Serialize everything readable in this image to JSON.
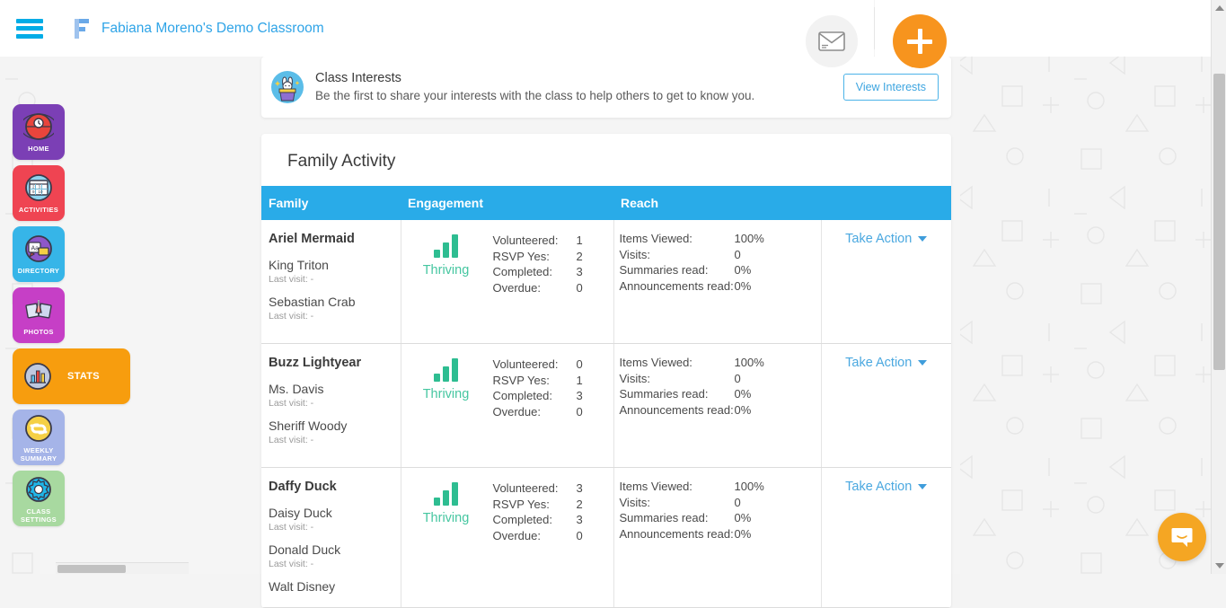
{
  "header": {
    "menu_icon": "hamburger-menu-icon",
    "logo_icon": "f-logo-icon",
    "class_title": "Fabiana Moreno's Demo Classroom",
    "mail_icon": "envelope-icon",
    "add_icon": "plus-icon"
  },
  "sidebar": {
    "items": [
      {
        "label": "HOME",
        "icon": "home-globe-icon",
        "color": "#7b3fb5",
        "active": false
      },
      {
        "label": "ACTIVITIES",
        "icon": "calendar-globe-icon",
        "color": "#ef4452",
        "active": false
      },
      {
        "label": "DIRECTORY",
        "icon": "directory-icon",
        "color": "#36b5e8",
        "active": false
      },
      {
        "label": "PHOTOS",
        "icon": "photos-icon",
        "color": "#c63fc6",
        "active": false
      },
      {
        "label": "STATS",
        "icon": "stats-chart-icon",
        "color": "#f79d0e",
        "active": true
      },
      {
        "label": "WEEKLY\nSUMMARY",
        "icon": "refresh-cycle-icon",
        "color": "#a5b4e8",
        "active": false
      },
      {
        "label": "CLASS\nSETTINGS",
        "icon": "gear-icon",
        "color": "#a8d9a0",
        "active": false
      }
    ]
  },
  "interests_banner": {
    "icon": "magic-hat-rabbit-icon",
    "title": "Class Interests",
    "subtitle": "Be the first to share your interests with the class to help others to get to know you.",
    "button_label": "View Interests"
  },
  "family_activity": {
    "title": "Family Activity",
    "columns": [
      "Family",
      "Engagement",
      "Reach",
      ""
    ],
    "engagement_keys": [
      "Volunteered:",
      "RSVP Yes:",
      "Completed:",
      "Overdue:"
    ],
    "reach_keys": [
      "Items Viewed:",
      "Visits:",
      "Summaries read:",
      "Announcements read:"
    ],
    "action_label": "Take Action",
    "last_visit_label": "Last visit: -",
    "rows": [
      {
        "family": "Ariel Mermaid",
        "members": [
          {
            "name": "King Triton",
            "last_visit": "Last visit: -"
          },
          {
            "name": "Sebastian Crab",
            "last_visit": "Last visit: -"
          }
        ],
        "status": "Thriving",
        "engagement_values": [
          "1",
          "2",
          "3",
          "0"
        ],
        "reach_values": [
          "100%",
          "0",
          "0%",
          "0%"
        ],
        "action": "Take Action"
      },
      {
        "family": "Buzz Lightyear",
        "members": [
          {
            "name": "Ms. Davis",
            "last_visit": "Last visit: -"
          },
          {
            "name": "Sheriff Woody",
            "last_visit": "Last visit: -"
          }
        ],
        "status": "Thriving",
        "engagement_values": [
          "0",
          "1",
          "3",
          "0"
        ],
        "reach_values": [
          "100%",
          "0",
          "0%",
          "0%"
        ],
        "action": "Take Action"
      },
      {
        "family": "Daffy Duck",
        "members": [
          {
            "name": "Daisy Duck",
            "last_visit": "Last visit: -"
          },
          {
            "name": "Donald Duck",
            "last_visit": "Last visit: -"
          },
          {
            "name": "Walt Disney",
            "last_visit": ""
          }
        ],
        "status": "Thriving",
        "engagement_values": [
          "3",
          "2",
          "3",
          "0"
        ],
        "reach_values": [
          "100%",
          "0",
          "0%",
          "0%"
        ],
        "action": "Take Action"
      }
    ]
  },
  "chat": {
    "icon": "chat-bubble-icon"
  },
  "colors": {
    "accent_blue": "#29abe8",
    "link_blue": "#3da5e0",
    "thriving_green": "#2ebd91",
    "orange": "#f7941e"
  }
}
